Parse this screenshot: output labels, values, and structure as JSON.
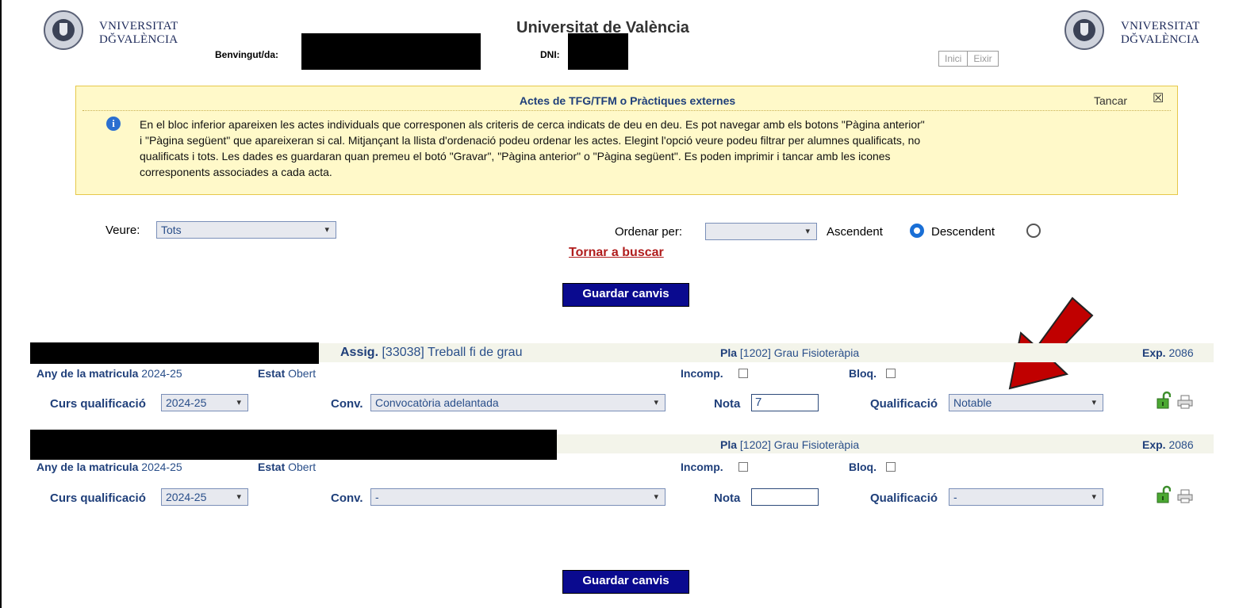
{
  "header": {
    "brand_line1": "VNIVERSITAT",
    "brand_line2": "DĞVALÈNCIA",
    "title": "Universitat de València",
    "welcome_label": "Benvingut/da:",
    "dni_label": "DNI:",
    "nav": {
      "inici": "Inici",
      "eixir": "Eixir"
    }
  },
  "info": {
    "title": "Actes de TFG/TFM o Pràctiques externes",
    "close_label": "Tancar",
    "close_icon": "☒",
    "info_icon": "info-icon",
    "lines": [
      "En el bloc inferior apareixen les actes individuals que corresponen als criteris de cerca indicats de deu en deu. Es pot navegar amb els botons \"Pàgina anterior\"",
      "i \"Pàgina següent\" que apareixeran si cal. Mitjançant la llista d'ordenació podeu ordenar les actes. Elegint l'opció veure podeu filtrar per alumnes qualificats, no",
      "qualificats i tots. Les dades es guardaran quan premeu el botó \"Gravar\", \"Pàgina anterior\" o \"Pàgina següent\". Es poden imprimir i tancar amb les icones",
      "corresponents associades a cada acta."
    ]
  },
  "filters": {
    "veure_label": "Veure:",
    "veure_value": "Tots",
    "ordenar_label": "Ordenar per:",
    "ordenar_value": "",
    "asc_label": "Ascendent",
    "desc_label": "Descendent",
    "selected_order": "Ascendent",
    "back_link": "Tornar a buscar"
  },
  "save_label": "Guardar canvis",
  "records": [
    {
      "assig_label": "Assig.",
      "assig_value": "[33038] Treball fi de grau",
      "pla_label": "Pla",
      "pla_value": "[1202] Grau Fisioteràpia",
      "exp_label": "Exp.",
      "exp_value": "2086",
      "any_label": "Any de la matricula",
      "any_value": "2024-25",
      "estat_label": "Estat",
      "estat_value": "Obert",
      "incomp_label": "Incomp.",
      "bloq_label": "Bloq.",
      "curs_label": "Curs qualificació",
      "curs_value": "2024-25",
      "conv_label": "Conv.",
      "conv_value": "Convocatòria adelantada",
      "nota_label": "Nota",
      "nota_value": "7",
      "qual_label": "Qualificació",
      "qual_value": "Notable"
    },
    {
      "pla_label": "Pla",
      "pla_value": "[1202] Grau Fisioteràpia",
      "exp_label": "Exp.",
      "exp_value": "2086",
      "any_label": "Any de la matricula",
      "any_value": "2024-25",
      "estat_label": "Estat",
      "estat_value": "Obert",
      "incomp_label": "Incomp.",
      "bloq_label": "Bloq.",
      "curs_label": "Curs qualificació",
      "curs_value": "2024-25",
      "conv_label": "Conv.",
      "conv_value": "-",
      "nota_label": "Nota",
      "nota_value": "",
      "qual_label": "Qualificació",
      "qual_value": "-"
    }
  ],
  "colors": {
    "arrow": "#c00000",
    "button": "#0a0a8f",
    "label": "#1f3f7a",
    "link": "#b01c1c"
  },
  "icons": {
    "lock": "unlock-icon",
    "print": "print-icon",
    "caret": "▾"
  }
}
